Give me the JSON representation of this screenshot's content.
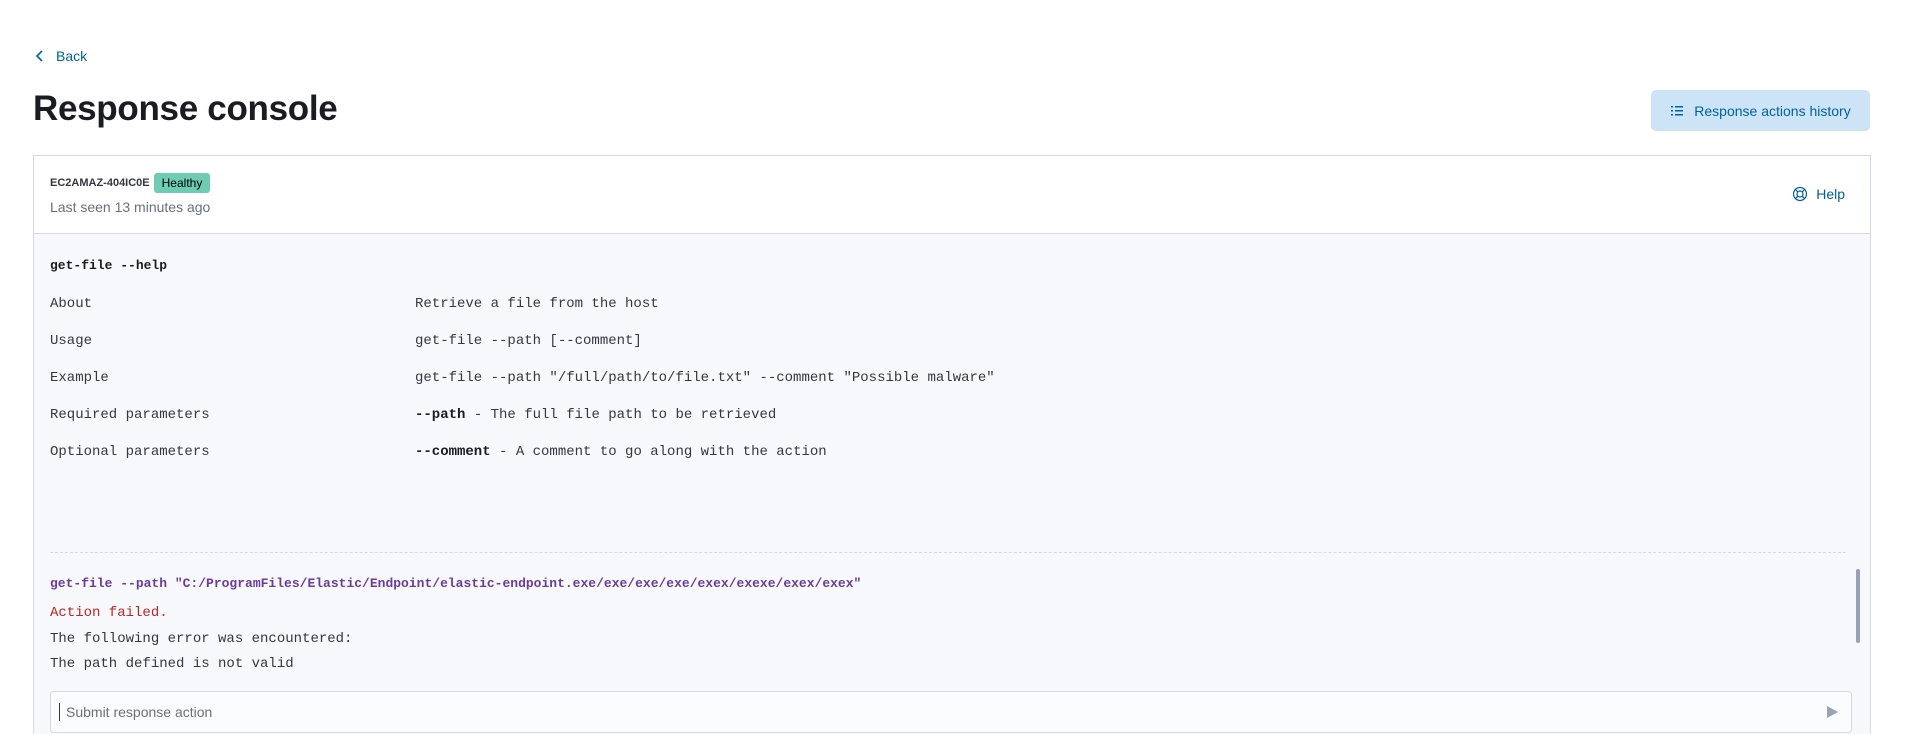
{
  "nav": {
    "back_label": "Back"
  },
  "page": {
    "title": "Response console"
  },
  "actions": {
    "history_label": "Response actions history"
  },
  "host": {
    "name": "EC2AMAZ-404IC0E",
    "status": "Healthy",
    "last_seen": "Last seen 13 minutes ago"
  },
  "help": {
    "label": "Help"
  },
  "console": {
    "help_command": "get-file --help",
    "help_rows": [
      {
        "label": "About",
        "value": "Retrieve a file from the host"
      },
      {
        "label": "Usage",
        "value": "get-file --path [--comment]"
      },
      {
        "label": "Example",
        "value": "get-file --path \"/full/path/to/file.txt\" --comment \"Possible malware\""
      },
      {
        "label": "Required parameters",
        "flag": "--path",
        "value": " - The full file path to be retrieved"
      },
      {
        "label": "Optional parameters",
        "flag": "--comment",
        "value": " - A comment to go along with the action"
      }
    ],
    "run_command": "get-file --path \"C:/ProgramFiles/Elastic/Endpoint/elastic-endpoint.exe/exe/exe/exe/exex/exexe/exex/exex\"",
    "error_title": "Action failed.",
    "error_line1": "The following error was encountered:",
    "error_line2": "The path defined is not valid"
  },
  "input": {
    "placeholder": "Submit response action"
  },
  "colors": {
    "link": "#0061a6",
    "badge_healthy": "#6dccb1",
    "error": "#bd271e",
    "command": "#6b3c9e"
  },
  "icons": [
    "arrow-left-icon",
    "list-icon",
    "help-lifebuoy-icon",
    "play-icon"
  ]
}
